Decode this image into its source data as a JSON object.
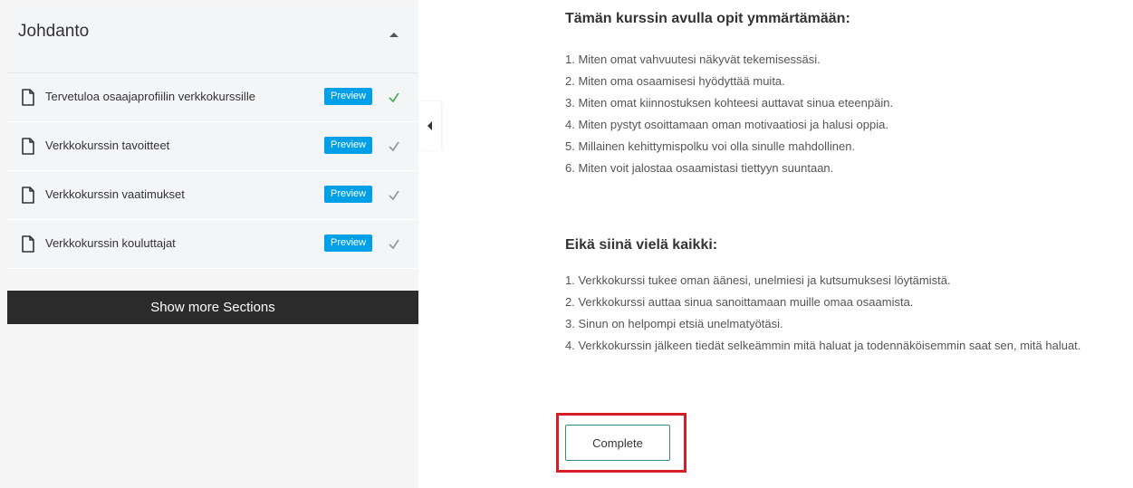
{
  "sidebar": {
    "section_title": "Johdanto",
    "lessons": [
      {
        "label": "Tervetuloa osaajaprofiilin verkkokurssille",
        "badge": "Preview",
        "check_color": "#4caf50"
      },
      {
        "label": "Verkkokurssin tavoitteet",
        "badge": "Preview",
        "check_color": "#999999"
      },
      {
        "label": "Verkkokurssin vaatimukset",
        "badge": "Preview",
        "check_color": "#999999"
      },
      {
        "label": "Verkkokurssin kouluttajat",
        "badge": "Preview",
        "check_color": "#999999"
      }
    ],
    "show_more_label": "Show more Sections"
  },
  "main": {
    "heading1": "Tämän kurssin avulla opit ymmärtämään:",
    "list1": [
      "1. Miten omat vahvuutesi näkyvät tekemisessäsi.",
      "2. Miten oma osaamisesi hyödyttää muita.",
      "3. Miten omat kiinnostuksen kohteesi auttavat sinua eteenpäin.",
      "4. Miten pystyt osoittamaan oman motivaatiosi ja halusi oppia.",
      "5. Millainen kehittymispolku voi olla sinulle mahdollinen.",
      "6. Miten voit jalostaa osaamistasi tiettyyn suuntaan."
    ],
    "heading2": "Eikä siinä vielä kaikki:",
    "list2": [
      "1. Verkkokurssi tukee oman äänesi, unelmiesi ja kutsumuksesi löytämistä.",
      "2. Verkkokurssi auttaa sinua sanoittamaan muille omaa osaamista.",
      "3. Sinun on helpompi etsiä unelmatyötäsi.",
      "4. Verkkokurssin jälkeen tiedät selkeämmin mitä haluat ja todennäköisemmin saat sen, mitä haluat."
    ],
    "complete_label": "Complete"
  },
  "colors": {
    "preview_badge": "#00a0e9",
    "show_more_bg": "#2b2b2b",
    "highlight_outline": "#d51e26"
  }
}
